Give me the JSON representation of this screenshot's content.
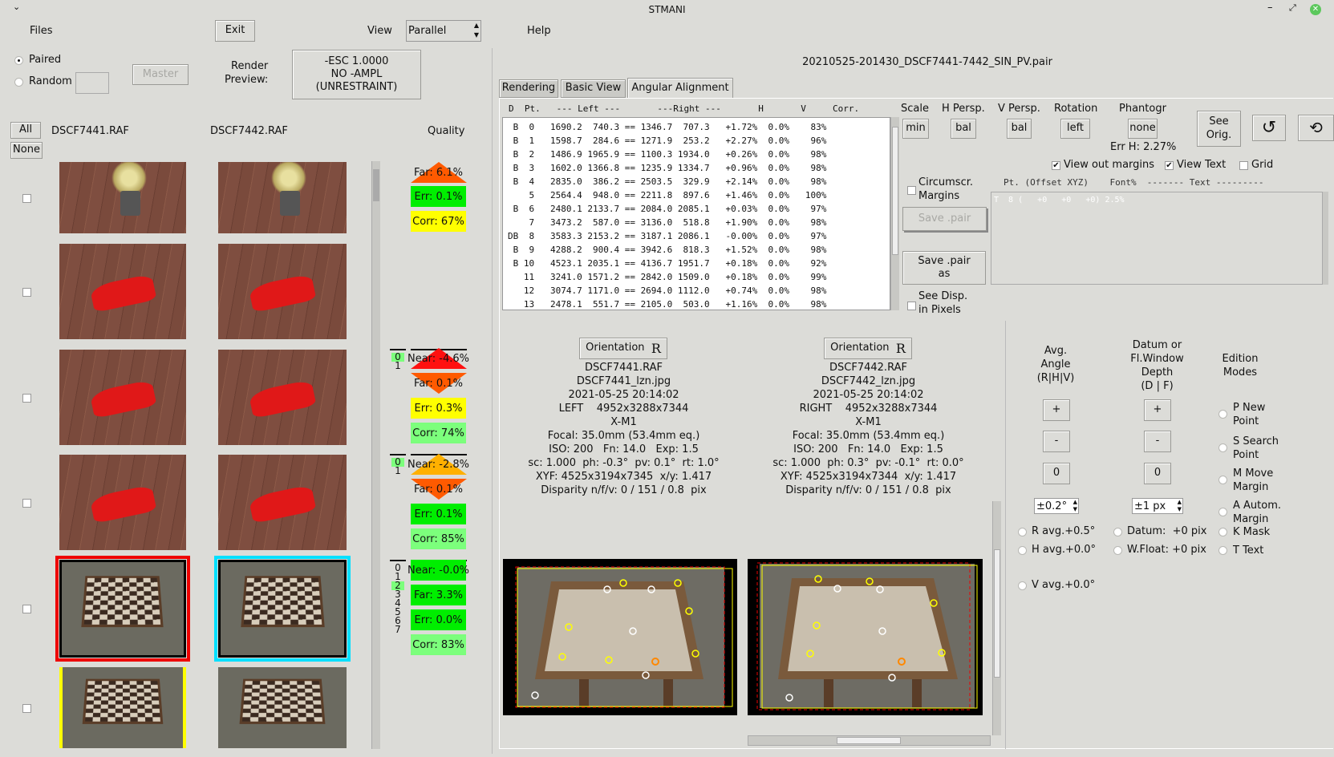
{
  "window": {
    "title": "STMANI",
    "menu_icon": "chevron-down-icon"
  },
  "top": {
    "files": "Files",
    "exit": "Exit",
    "view_label": "View",
    "view_value": "Parallel",
    "help": "Help",
    "paired": "Paired",
    "random": "Random",
    "master": "Master",
    "render_preview": "Render\nPreview:",
    "esc_button": [
      "-ESC 1.0000",
      "NO -AMPL",
      "(UNRESTRAINT)"
    ]
  },
  "files_list": {
    "all": "All",
    "none": "None",
    "left_file": "DSCF7441.RAF",
    "right_file": "DSCF7442.RAF",
    "quality": "Quality",
    "thumbnails": [
      "flowers",
      "car",
      "car",
      "car",
      "chess",
      "chess"
    ]
  },
  "quality": [
    {
      "indices": [],
      "items": [
        {
          "t": "Far: 6.1%",
          "shape": "up",
          "color": "#ff5a00"
        },
        {
          "t": "Err: 0.1%",
          "color": "#00ee00"
        },
        {
          "t": "Corr: 67%",
          "color": "#ffff00"
        }
      ]
    },
    {
      "indices": [
        "0",
        "1"
      ],
      "hl": 0,
      "items": [
        {
          "t": "Near: -4.6%",
          "shape": "up",
          "color": "#ff1010"
        },
        {
          "t": "Far: 0.1%",
          "shape": "down",
          "color": "#ff5a00"
        },
        {
          "t": "Err: 0.3%",
          "color": "#ffff00"
        },
        {
          "t": "Corr: 74%",
          "color": "#7cff7c"
        }
      ]
    },
    {
      "indices": [
        "0",
        "1"
      ],
      "hl": 0,
      "items": [
        {
          "t": "Near: -2.8%",
          "shape": "up",
          "color": "#ffb000"
        },
        {
          "t": "Far: 0.1%",
          "shape": "down",
          "color": "#ff5a00"
        },
        {
          "t": "Err: 0.1%",
          "color": "#00ee00"
        },
        {
          "t": "Corr: 85%",
          "color": "#7cff7c"
        }
      ]
    },
    {
      "indices": [
        "0",
        "1",
        "2",
        "3",
        "4",
        "5",
        "6",
        "7"
      ],
      "hl": 2,
      "items": [
        {
          "t": "Near: -0.0%",
          "color": "#00ee00"
        },
        {
          "t": "Far: 3.3%",
          "color": "#00ee00"
        },
        {
          "t": "Err: 0.0%",
          "color": "#00ee00"
        },
        {
          "t": "Corr: 83%",
          "color": "#7cff7c"
        }
      ]
    }
  ],
  "pair_file": "20210525-201430_DSCF7441-7442_SIN_PV.pair",
  "tabs": [
    "Rendering",
    "Basic View",
    "Angular Alignment"
  ],
  "points_table": {
    "header": "D  Pt.   --- Left ---       ---Right ---       H       V     Corr.",
    "rows": [
      [
        "B",
        " 0",
        "1690.2",
        " 740.3",
        "1346.7",
        " 707.3",
        "+1.72%",
        "0.0%",
        " 83%"
      ],
      [
        "B",
        " 1",
        "1598.7",
        " 284.6",
        "1271.9",
        " 253.2",
        "+2.27%",
        "0.0%",
        " 96%"
      ],
      [
        "B",
        " 2",
        "1486.9",
        "1965.9",
        "1100.3",
        "1934.0",
        "+0.26%",
        "0.0%",
        " 98%"
      ],
      [
        "B",
        " 3",
        "1602.0",
        "1366.8",
        "1235.9",
        "1334.7",
        "+0.96%",
        "0.0%",
        " 98%"
      ],
      [
        "B",
        " 4",
        "2835.0",
        " 386.2",
        "2503.5",
        " 329.9",
        "+2.14%",
        "0.0%",
        " 98%"
      ],
      [
        " ",
        " 5",
        "2564.4",
        " 948.0",
        "2211.8",
        " 897.6",
        "+1.46%",
        "0.0%",
        "100%"
      ],
      [
        "B",
        " 6",
        "2480.1",
        "2133.7",
        "2084.0",
        "2085.1",
        "+0.03%",
        "0.0%",
        " 97%"
      ],
      [
        " ",
        " 7",
        "3473.2",
        " 587.0",
        "3136.0",
        " 518.8",
        "+1.90%",
        "0.0%",
        " 98%"
      ],
      [
        "DB",
        " 8",
        "3583.3",
        "2153.2",
        "3187.1",
        "2086.1",
        "-0.00%",
        "0.0%",
        " 97%"
      ],
      [
        "B",
        " 9",
        "4288.2",
        " 900.4",
        "3942.6",
        " 818.3",
        "+1.52%",
        "0.0%",
        " 98%"
      ],
      [
        "B",
        "10",
        "4523.1",
        "2035.1",
        "4136.7",
        "1951.7",
        "+0.18%",
        "0.0%",
        " 92%"
      ],
      [
        " ",
        "11",
        "3241.0",
        "1571.2",
        "2842.0",
        "1509.0",
        "+0.18%",
        "0.0%",
        " 99%"
      ],
      [
        " ",
        "12",
        "3074.7",
        "1171.0",
        "2694.0",
        "1112.0",
        "+0.74%",
        "0.0%",
        " 98%"
      ],
      [
        " ",
        "13",
        "2478.1",
        " 551.7",
        "2105.0",
        " 503.0",
        "+1.16%",
        "0.0%",
        " 98%"
      ]
    ]
  },
  "controls": {
    "scale": "Scale",
    "scale_val": "min",
    "hpersp": "H Persp.",
    "hpersp_val": "bal",
    "vpersp": "V Persp.",
    "vpersp_val": "bal",
    "rotation": "Rotation",
    "rotation_val": "left",
    "phantogr": "Phantogr",
    "phantogr_val": "none",
    "see_orig": "See\nOrig.",
    "err_h": "Err H: 2.27%",
    "view_out_margins": "View out margins",
    "view_text": "View Text",
    "grid": "Grid",
    "circumscr": "Circumscr.\nMargins",
    "save_pair": "Save .pair",
    "save_pair_as": "Save .pair\nas",
    "see_disp": "See Disp.\nin Pixels",
    "text_header": "Pt. (Offset XYZ)    Font%  ------- Text ---------",
    "text_line": "T  8 (   +0   +0   +0) 2.5%",
    "rotate_icon": "rotate-ccw-icon",
    "rotate_reset_icon": "rotate-reset-icon"
  },
  "left_info": {
    "orientation": "Orientation",
    "orient_glyph": "R",
    "lines": [
      "DSCF7441.RAF",
      "DSCF7441_lzn.jpg",
      "2021-05-25 20:14:02",
      "LEFT    4952x3288x7344",
      "X-M1",
      "Focal: 35.0mm (53.4mm eq.)",
      "ISO: 200   Fn: 14.0   Exp: 1.5",
      "sc: 1.000  ph: -0.3°  pv: 0.1°  rt: 1.0°",
      "XYF: 4525x3194x7345  x/y: 1.417",
      "Disparity n/f/v: 0 / 151 / 0.8  pix"
    ]
  },
  "right_info": {
    "orientation": "Orientation",
    "orient_glyph": "R",
    "lines": [
      "DSCF7442.RAF",
      "DSCF7442_lzn.jpg",
      "2021-05-25 20:14:02",
      "RIGHT    4952x3288x7344",
      "X-M1",
      "Focal: 35.0mm (53.4mm eq.)",
      "ISO: 200   Fn: 14.0   Exp: 1.5",
      "sc: 1.000  ph: 0.3°  pv: -0.1°  rt: 0.0°",
      "XYF: 4525x3194x7344  x/y: 1.417",
      "Disparity n/f/v: 0 / 151 / 0.8  pix"
    ]
  },
  "adjust": {
    "avg_angle": "Avg.\nAngle\n(R|H|V)",
    "datum": "Datum or\nFl.Window\nDepth\n(D | F)",
    "edition": "Edition\nModes",
    "plus": "+",
    "minus": "-",
    "zero": "0",
    "angle_step": "±0.2°",
    "px_step": "±1 px",
    "r_avg": "R avg.+0.5°",
    "h_avg": "H avg.+0.0°",
    "v_avg": "V avg.+0.0°",
    "datum_val": "Datum:  +0 pix",
    "wfloat": "W.Float: +0 pix",
    "modes": [
      "P New\nPoint",
      "S Search\nPoint",
      "M Move\nMargin",
      "A Autom.\nMargin",
      "K Mask",
      "T Text"
    ]
  }
}
